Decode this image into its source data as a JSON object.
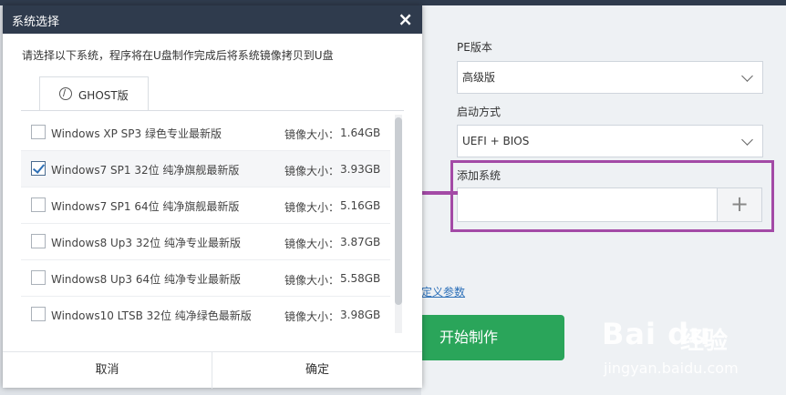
{
  "background": {
    "pe_version_label": "PE版本",
    "pe_version_value": "高级版",
    "boot_mode_label": "启动方式",
    "boot_mode_value": "UEFI + BIOS",
    "add_system_label": "添加系统",
    "add_button": "+",
    "custom_params_link": "定义参数",
    "start_button": "开始制作",
    "colors": {
      "highlight": "#a34aa6",
      "start": "#2aa55a",
      "titlebar": "#2f3b4d"
    }
  },
  "watermark": {
    "logo": "Bai du",
    "jingyan": "经验",
    "url": "jingyan.baidu.com"
  },
  "dialog": {
    "title": "系统选择",
    "close": "×",
    "instruction": "请选择以下系统，程序将在U盘制作完成后将系统镜像拷贝到U盘",
    "tab_label": "GHOST版",
    "size_label": "镜像大小：",
    "items": [
      {
        "name": "Windows XP SP3 绿色专业最新版",
        "size": "1.64GB",
        "checked": false
      },
      {
        "name": "Windows7 SP1 32位 纯净旗舰最新版",
        "size": "3.93GB",
        "checked": true
      },
      {
        "name": "Windows7 SP1 64位 纯净旗舰最新版",
        "size": "5.16GB",
        "checked": false
      },
      {
        "name": "Windows8 Up3 32位 纯净专业最新版",
        "size": "3.87GB",
        "checked": false
      },
      {
        "name": "Windows8 Up3 64位 纯净专业最新版",
        "size": "5.58GB",
        "checked": false
      },
      {
        "name": "Windows10 LTSB 32位 纯净绿色最新版",
        "size": "3.98GB",
        "checked": false
      }
    ],
    "cancel": "取消",
    "ok": "确定"
  }
}
